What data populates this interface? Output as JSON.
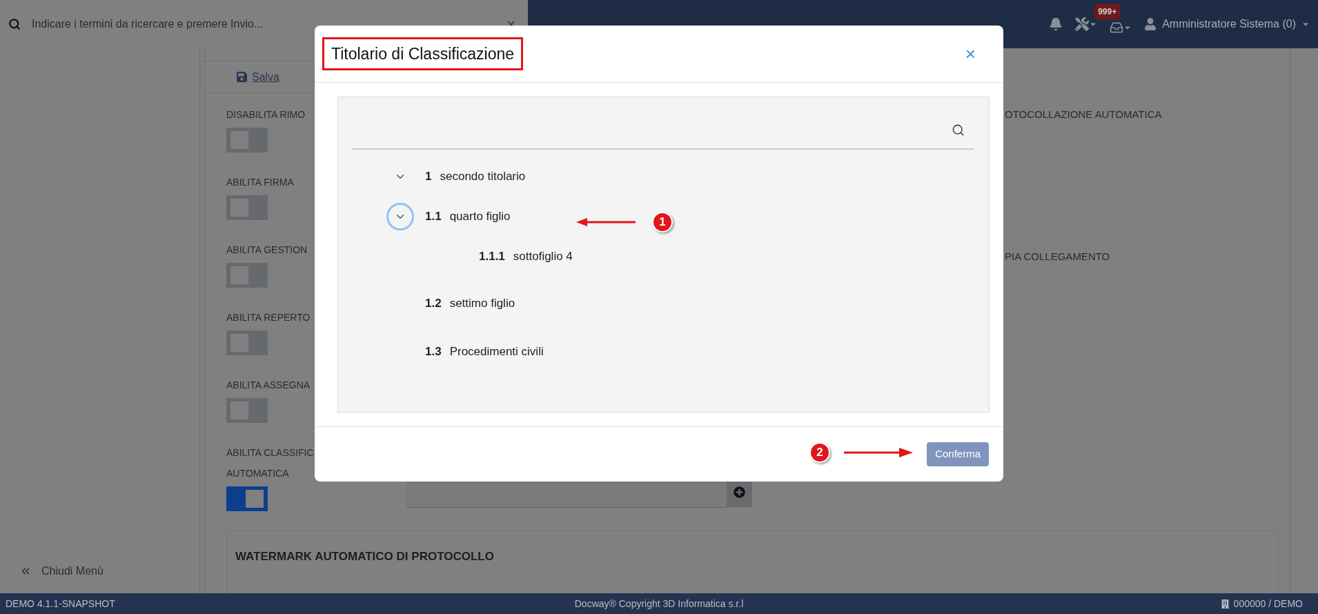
{
  "top_bar": {
    "search": {
      "placeholder": "Indicare i termini da ricercare e premere Invio...",
      "clear": "×"
    },
    "notification_badge": "999+",
    "user": "Amministratore Sistema (0)"
  },
  "sidebar": {
    "collapse": "Chiudi Menù"
  },
  "toolbar": {
    "save": "Salva"
  },
  "settings_left": [
    {
      "label_lines": [
        "DISABILITA RIMO"
      ],
      "on": false
    },
    {
      "label_lines": [
        "ABILITA FIRMA"
      ],
      "on": false
    },
    {
      "label_lines": [
        "ABILITA GESTION"
      ],
      "on": false
    },
    {
      "label_lines": [
        "ABILITA REPERTO"
      ],
      "on": false
    },
    {
      "label_lines": [
        "ABILITA ASSEGNA"
      ],
      "on": false
    },
    {
      "label_lines": [
        "ABILITA CLASSIFIC",
        "AUTOMATICA"
      ],
      "on": true
    }
  ],
  "settings_right": [
    "OTOCOLLAZIONE AUTOMATICA",
    "PIA COLLEGAMENTO"
  ],
  "watermark_section": {
    "title": "WATERMARK AUTOMATICO DI PROTOCOLLO"
  },
  "dialog": {
    "title": "Titolario di Classificazione",
    "close": "×",
    "confirm": "Conferma",
    "tree": [
      {
        "number": "1",
        "label": "secondo titolario",
        "expanded": true,
        "focused": false,
        "children": [
          {
            "number": "1.1",
            "label": "quarto figlio",
            "expanded": true,
            "focused": true,
            "children": [
              {
                "number": "1.1.1",
                "label": "sottofiglio 4"
              }
            ]
          },
          {
            "number": "1.2",
            "label": "settimo figlio"
          },
          {
            "number": "1.3",
            "label": "Procedimenti civili"
          }
        ]
      }
    ]
  },
  "annotations": [
    {
      "number": "1"
    },
    {
      "number": "2"
    }
  ],
  "status_bar": {
    "version": "DEMO 4.1.1-SNAPSHOT",
    "copyright": "Docway® Copyright 3D Informatica s.r.l",
    "office": "000000 / DEMO"
  }
}
